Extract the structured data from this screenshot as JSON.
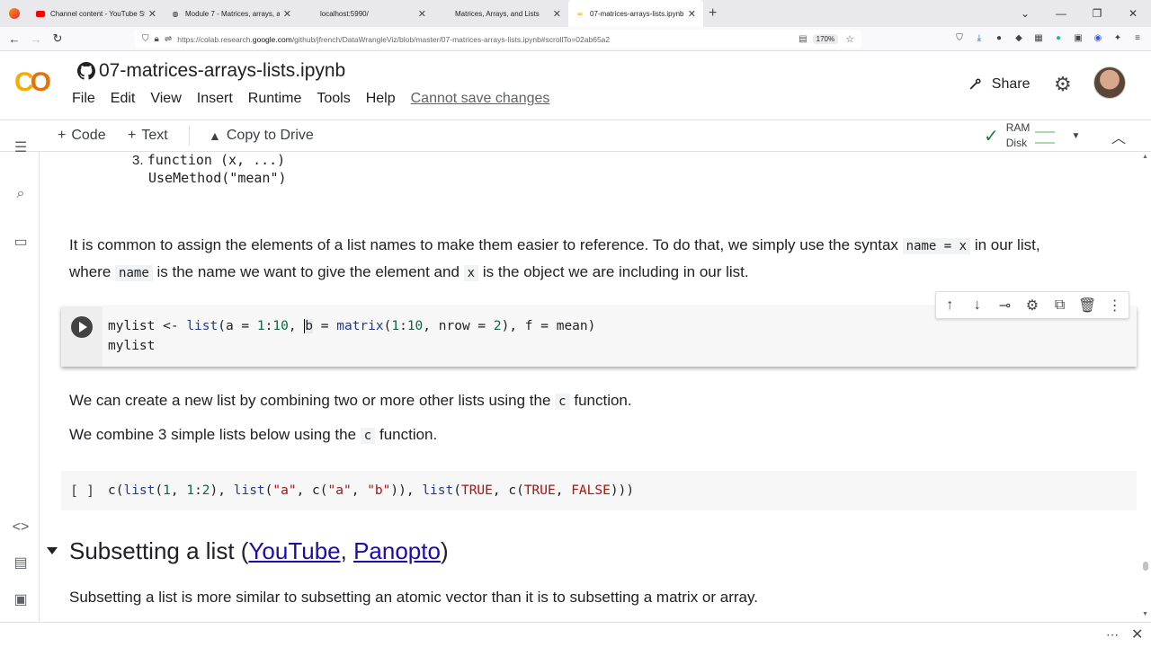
{
  "browser": {
    "tabs": [
      {
        "title": "Channel content - YouTube Stu",
        "icon": "youtube-icon"
      },
      {
        "title": "Module 7 - Matrices, arrays, an",
        "icon": "canvas-icon"
      },
      {
        "title": "localhost:5990/",
        "icon": "page-icon"
      },
      {
        "title": "Matrices, Arrays, and Lists",
        "icon": "page-icon"
      },
      {
        "title": "07-matrices-arrays-lists.ipynb",
        "icon": "colab-icon"
      }
    ],
    "url_prefix": "https://colab.research.",
    "url_domain": "google.com",
    "url_suffix": "/github/jfrench/DataWrangleViz/blob/master/07-matrices-arrays-lists.ipynb#scrollTo=02ab65a2",
    "zoom": "170%"
  },
  "colab": {
    "notebook_title": "07-matrices-arrays-lists.ipynb",
    "menu": [
      "File",
      "Edit",
      "View",
      "Insert",
      "Runtime",
      "Tools",
      "Help"
    ],
    "cannot_save": "Cannot save changes",
    "share_label": "Share"
  },
  "toolbar": {
    "code_label": "Code",
    "text_label": "Text",
    "copy_label": "Copy to Drive",
    "ram_label": "RAM",
    "disk_label": "Disk"
  },
  "notebook": {
    "list_item_number": "3.",
    "list_code_line1": "function (x, ...)",
    "list_code_line2": "UseMethod(\"mean\")",
    "para1_a": "It is common to assign the elements of a list names to make them easier to reference. To do that, we simply use the syntax",
    "para1_code1": "name = x",
    "para1_b": "in our list,",
    "para2_a": "where",
    "para2_code1": "name",
    "para2_b": "is the name we want to give the element and",
    "para2_code2": "x",
    "para2_c": "is the object we are including in our list.",
    "cell1": {
      "line2": "mylist"
    },
    "para3_a": "We can create a new list by combining two or more other lists using the",
    "para3_code": "c",
    "para3_b": "function.",
    "para4_a": "We combine 3 simple lists below using the",
    "para4_code": "c",
    "para4_b": "function.",
    "cell2_bracket": "[ ]",
    "heading_text": "Subsetting a list (",
    "heading_link1": "YouTube",
    "heading_sep": ", ",
    "heading_link2": "Panopto",
    "heading_end": ")",
    "para5": "Subsetting a list is more similar to subsetting an atomic vector than it is to subsetting a matrix or array."
  }
}
